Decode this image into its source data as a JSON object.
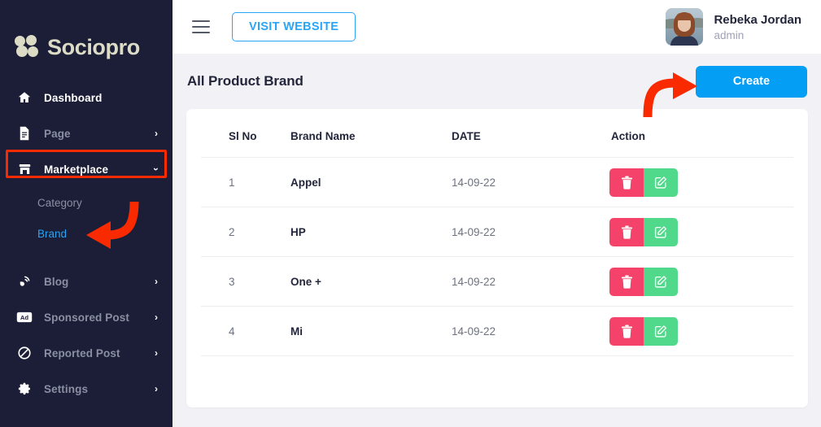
{
  "brand": {
    "name": "Sociopro",
    "logo_icon": "four-dots-logo-icon",
    "logo_color": "#dcdcc6"
  },
  "sidebar": {
    "background": "#1b1e36",
    "items": [
      {
        "label": "Dashboard",
        "icon": "home-icon",
        "chevron": "",
        "state": "active"
      },
      {
        "label": "Page",
        "icon": "document-icon",
        "chevron": "›",
        "state": "collapsed"
      },
      {
        "label": "Marketplace",
        "icon": "store-icon",
        "chevron": "›",
        "state": "expanded"
      },
      {
        "label": "Blog",
        "icon": "blog-rss-icon",
        "chevron": "›",
        "state": "collapsed"
      },
      {
        "label": "Sponsored Post",
        "icon": "ad-badge-icon",
        "chevron": "›",
        "state": "collapsed"
      },
      {
        "label": "Reported Post",
        "icon": "ban-icon",
        "chevron": "›",
        "state": "collapsed"
      },
      {
        "label": "Settings",
        "icon": "gear-icon",
        "chevron": "›",
        "state": "collapsed"
      }
    ],
    "submenu": [
      {
        "label": "Category",
        "selected": false
      },
      {
        "label": "Brand",
        "selected": true
      }
    ],
    "selected_color": "#29a3f5"
  },
  "topbar": {
    "menu_icon": "hamburger-icon",
    "visit_website_label": "VISIT WEBSITE",
    "visit_website_color": "#2aa5f7",
    "user": {
      "name": "Rebeka Jordan",
      "role": "admin",
      "avatar": "user-avatar-photo"
    }
  },
  "page": {
    "title": "All Product Brand",
    "create_label": "Create",
    "create_color": "#049ef4"
  },
  "table": {
    "columns": [
      "Sl No",
      "Brand Name",
      "DATE",
      "Action"
    ],
    "rows": [
      {
        "sl": "1",
        "name": "Appel",
        "date": "14-09-22"
      },
      {
        "sl": "2",
        "name": "HP",
        "date": "14-09-22"
      },
      {
        "sl": "3",
        "name": "One +",
        "date": "14-09-22"
      },
      {
        "sl": "4",
        "name": "Mi",
        "date": "14-09-22"
      }
    ],
    "actions": {
      "delete_icon": "trash-icon",
      "edit_icon": "edit-pencil-square-icon",
      "delete_color": "#f4426a",
      "edit_color": "#51d98b"
    }
  },
  "annotations": {
    "highlight_color": "#f92a00",
    "highlight_target": "Marketplace",
    "arrow_brand_target": "Brand",
    "arrow_create_target": "Create"
  }
}
